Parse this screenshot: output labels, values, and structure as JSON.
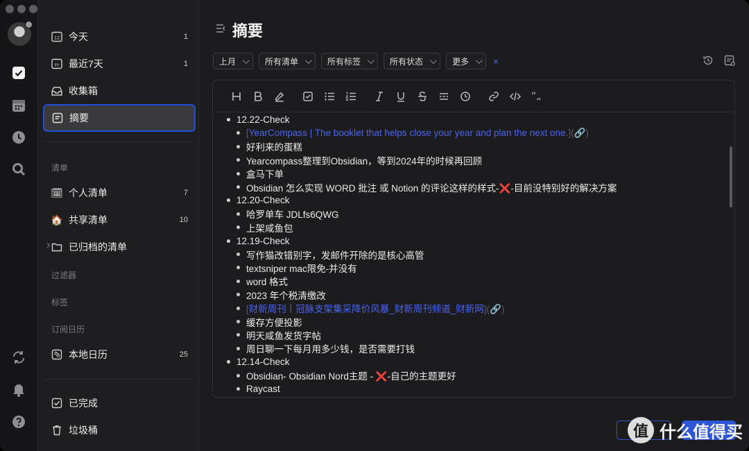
{
  "sidebar": {
    "items": [
      {
        "label": "今天",
        "count": "1"
      },
      {
        "label": "最近7天",
        "count": "1"
      },
      {
        "label": "收集箱",
        "count": ""
      },
      {
        "label": "摘要",
        "count": ""
      }
    ],
    "lists_header": "清单",
    "lists": [
      {
        "label": "个人清单",
        "count": "7",
        "emoji": "🗓"
      },
      {
        "label": "共享清单",
        "count": "10",
        "emoji": "🏠"
      },
      {
        "label": "已归档的清单",
        "count": ""
      }
    ],
    "filters_header": "过滤器",
    "tags_header": "标签",
    "calendar_header": "订阅日历",
    "calendar": {
      "label": "本地日历",
      "count": "25"
    },
    "completed": "已完成",
    "trash": "垃圾桶"
  },
  "main": {
    "title": "摘要",
    "filters": [
      "上月",
      "所有清单",
      "所有标签",
      "所有状态",
      "更多"
    ],
    "clear_filter": "×"
  },
  "content": {
    "rows": [
      {
        "level": 0,
        "text": "12.22-Check"
      },
      {
        "level": 1,
        "link": "YearCompass | The booklet that helps close your year and plan the next one."
      },
      {
        "level": 1,
        "text": "好利来的蛋糕"
      },
      {
        "level": 1,
        "text": "Yearcompass整理到Obsidian，等到2024年的时候再回顾"
      },
      {
        "level": 1,
        "text": "盒马下单"
      },
      {
        "level": 1,
        "text": "Obsidian 怎么实现 WORD 批注 或 Notion 的评论这样的样式-",
        "mark": "❌",
        "after": "-目前没特别好的解决方案"
      },
      {
        "level": 0,
        "text": "12.20-Check"
      },
      {
        "level": 1,
        "text": "哈罗单车 JDLfs6QWG"
      },
      {
        "level": 1,
        "text": "上架咸鱼包"
      },
      {
        "level": 0,
        "text": "12.19-Check"
      },
      {
        "level": 1,
        "text": "写作猫改错别字，发邮件开除的是核心高管"
      },
      {
        "level": 1,
        "text": "textsniper mac限免-并没有"
      },
      {
        "level": 1,
        "text": "word 格式"
      },
      {
        "level": 1,
        "text": "2023 年个税清缴改"
      },
      {
        "level": 1,
        "link": "财新周刊丨冠脉支架集采降价风暴_财新周刊频道_财新网"
      },
      {
        "level": 1,
        "text": "缓存方便投影"
      },
      {
        "level": 1,
        "text": "明天咸鱼发货字帖"
      },
      {
        "level": 1,
        "text": "周日聊一下每月用多少钱，是否需要打钱"
      },
      {
        "level": 0,
        "text": "12.14-Check"
      },
      {
        "level": 1,
        "text": "Obsidian- Obsidian Nord主题 - ",
        "mark": "❌",
        "after": "-自己的主题更好"
      },
      {
        "level": 1,
        "text": "Raycast"
      }
    ]
  },
  "watermark": {
    "text": "什么值得买",
    "glyph": "值"
  },
  "colors": {
    "accent": "#2d55d8",
    "link": "#4a64f0",
    "cross": "#e8232c"
  }
}
